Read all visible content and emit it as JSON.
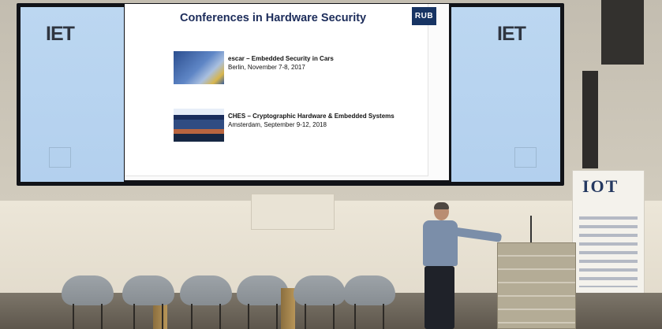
{
  "screen": {
    "left_logo": "IET",
    "right_logo": "IET"
  },
  "slide": {
    "title": "Conferences in Hardware Security",
    "badge": "RUB",
    "conferences": [
      {
        "name": "escar – Embedded Security in Cars",
        "detail": "Berlin, November 7-8, 2017",
        "thumbnail_icon": "escar-thumbnail-icon"
      },
      {
        "name": "CHES – Cryptographic Hardware & Embedded Systems",
        "detail": "Amsterdam, September 9-12, 2018",
        "thumbnail_icon": "ches-thumbnail-icon"
      }
    ]
  },
  "banner": {
    "logo": "IOT"
  },
  "colors": {
    "slide_title": "#1c2c5a",
    "rub_badge": "#173463",
    "side_screen": "#b3d0ee"
  }
}
